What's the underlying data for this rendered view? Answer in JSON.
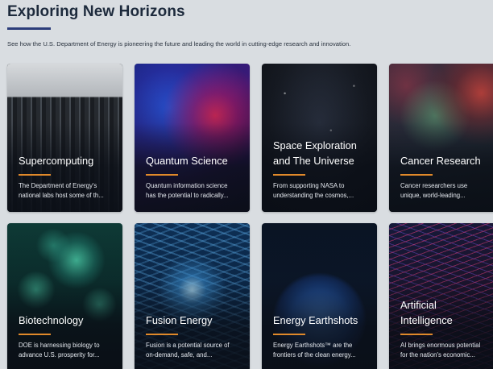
{
  "page": {
    "title": "Exploring New Horizons",
    "subtitle": "See how the U.S. Department of Energy is pioneering the future and leading the world in cutting-edge research and innovation.",
    "accent_color": "#e0892a",
    "rule_color": "#2c3d7a"
  },
  "cards": [
    {
      "title": "Supercomputing",
      "desc1": "The Department of Energy's",
      "desc2": "national labs host some of th..."
    },
    {
      "title": "Quantum Science",
      "desc1": "Quantum information science",
      "desc2": "has the potential to radically..."
    },
    {
      "title1": "Space Exploration",
      "title2": "and The Universe",
      "desc1": "From supporting NASA to",
      "desc2": "understanding the cosmos,..."
    },
    {
      "title": "Cancer Research",
      "desc1": "Cancer researchers use",
      "desc2": "unique, world-leading..."
    },
    {
      "title": "Biotechnology",
      "desc1": "DOE is harnessing biology to",
      "desc2": "advance U.S. prosperity for..."
    },
    {
      "title": "Fusion Energy",
      "desc1": "Fusion is a potential source of",
      "desc2": "on-demand, safe, and..."
    },
    {
      "title": "Energy Earthshots",
      "desc1": "Energy Earthshots™ are the",
      "desc2": "frontiers of the clean energy..."
    },
    {
      "title1": "Artificial",
      "title2": "Intelligence",
      "desc1": "AI brings enormous potential",
      "desc2": "for the nation's economic..."
    }
  ]
}
